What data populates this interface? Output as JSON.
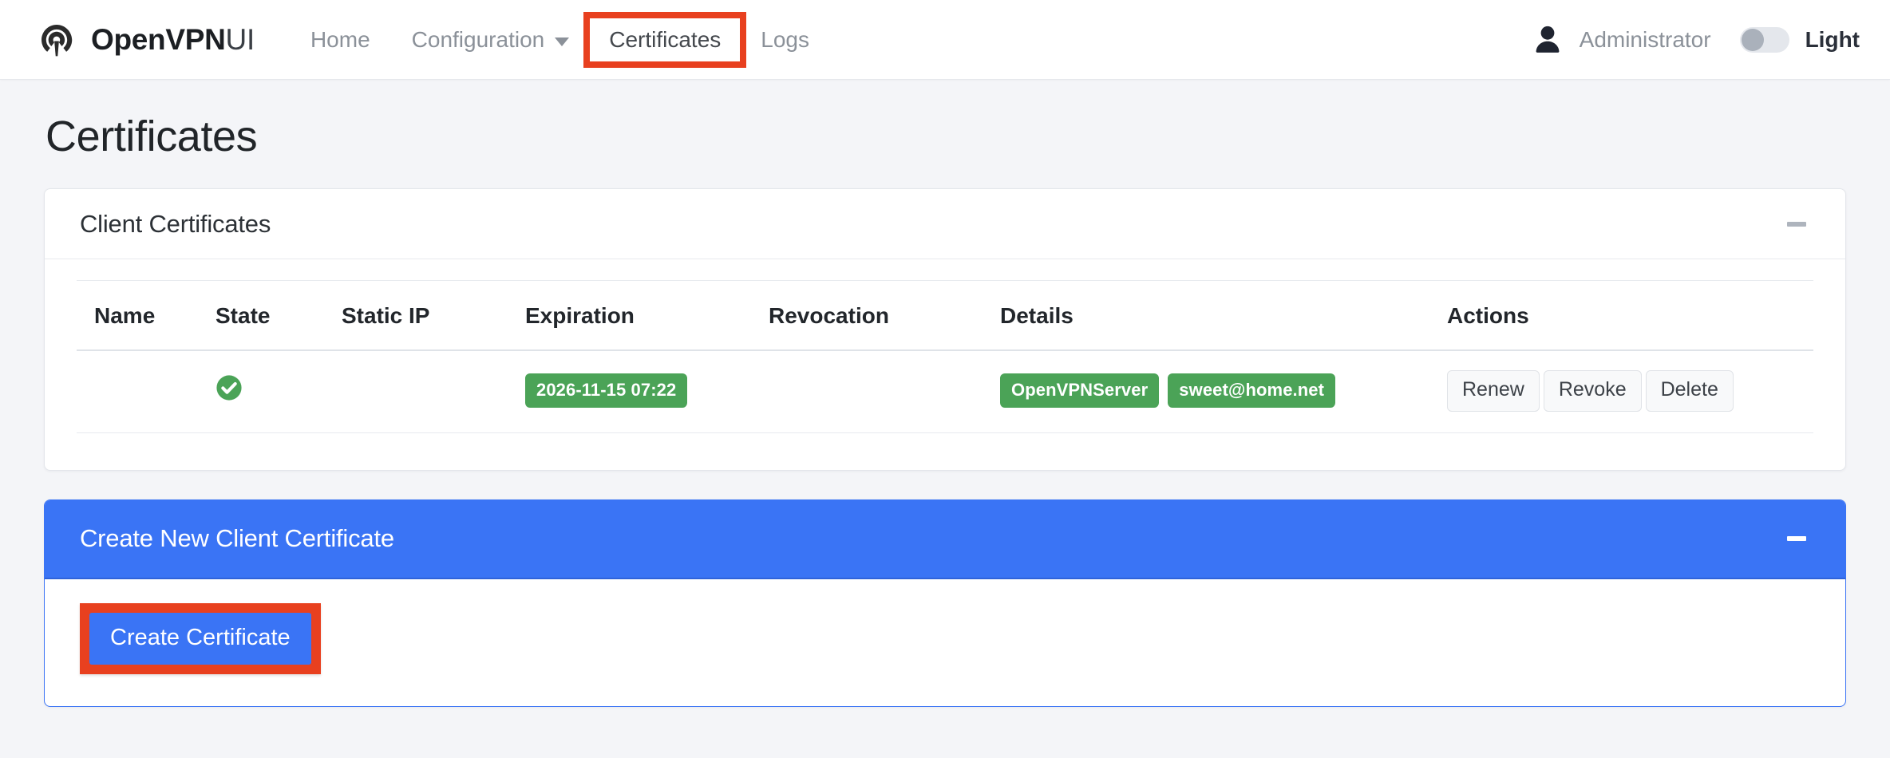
{
  "navbar": {
    "brand": {
      "strong": "OpenVPN",
      "light": "UI",
      "logo_icon": "openvpn-logo-icon"
    },
    "links": [
      {
        "label": "Home",
        "active": false,
        "has_caret": false
      },
      {
        "label": "Configuration",
        "active": false,
        "has_caret": true
      },
      {
        "label": "Certificates",
        "active": true,
        "has_caret": false,
        "highlighted": true
      },
      {
        "label": "Logs",
        "active": false,
        "has_caret": false
      }
    ],
    "user": {
      "icon": "user-avatar-icon",
      "name": "Administrator"
    },
    "theme": {
      "label": "Light",
      "state": "off"
    }
  },
  "page": {
    "title": "Certificates"
  },
  "client_certificates_panel": {
    "title": "Client Certificates",
    "collapse_icon": "minus-icon",
    "table": {
      "headers": [
        "Name",
        "State",
        "Static IP",
        "Expiration",
        "Revocation",
        "Details",
        "Actions"
      ],
      "rows": [
        {
          "name": "",
          "state_icon": "check-circle-icon",
          "static_ip": "",
          "expiration": "2026-11-15 07:22",
          "revocation": "",
          "details": [
            "OpenVPNServer",
            "sweet@home.net"
          ],
          "actions": [
            "Renew",
            "Revoke",
            "Delete"
          ]
        }
      ]
    }
  },
  "create_panel": {
    "title": "Create New Client Certificate",
    "collapse_icon": "minus-icon",
    "create_button": "Create Certificate"
  },
  "colors": {
    "accent_blue": "#3a74f5",
    "badge_green": "#4ba357",
    "highlight_red": "#e8401f",
    "page_background": "#f4f5f8",
    "muted_text": "#8b9199"
  }
}
